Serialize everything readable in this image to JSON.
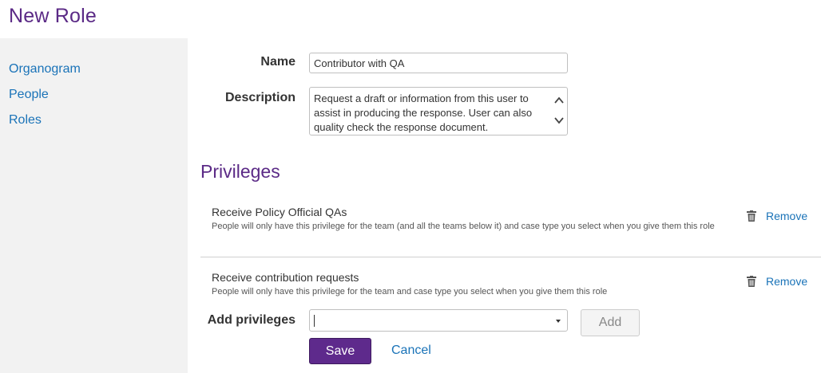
{
  "page": {
    "title": "New Role"
  },
  "sidebar": {
    "items": [
      {
        "label": "Organogram"
      },
      {
        "label": "People"
      },
      {
        "label": "Roles"
      }
    ]
  },
  "form": {
    "name_label": "Name",
    "name_value": "Contributor with QA",
    "description_label": "Description",
    "description_value": "Request a draft or information from this user to assist in producing the response.  User can also quality check the response document."
  },
  "privileges": {
    "title": "Privileges",
    "items": [
      {
        "name": "Receive Policy Official QAs",
        "description": "People will only have this privilege for the team (and all the teams below it) and case type you select when you give them this role",
        "remove_label": "Remove"
      },
      {
        "name": "Receive contribution requests",
        "description": "People will only have this privilege for the team and case type you select when you give them this role",
        "remove_label": "Remove"
      }
    ],
    "add_label": "Add privileges",
    "add_select_value": "",
    "add_button": "Add"
  },
  "actions": {
    "save": "Save",
    "cancel": "Cancel"
  },
  "colors": {
    "brand_purple": "#5b2a86",
    "link_blue": "#1a73b8",
    "sidebar_bg": "#f2f2f2"
  },
  "icons": {
    "remove": "trash-icon",
    "select": "chevron-down-icon",
    "scroll_up": "chevron-up-icon",
    "scroll_down": "chevron-down-icon"
  }
}
